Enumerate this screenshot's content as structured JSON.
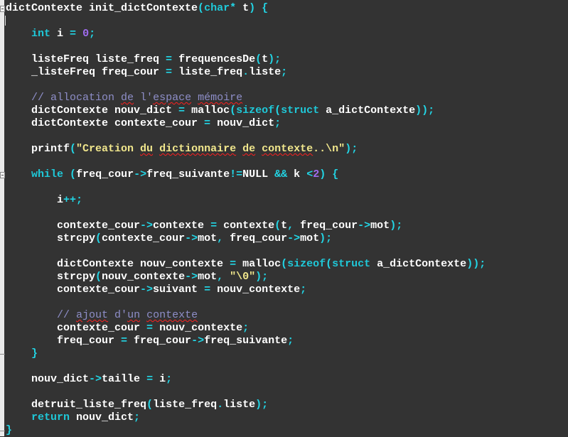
{
  "editor": {
    "language": "C",
    "colors": {
      "background": "#333333",
      "identifier": "#ffffff",
      "keyword": "#1fc8d8",
      "operator": "#22d6e6",
      "number": "#a06cf0",
      "string": "#f0e68c",
      "comment": "#8e8ec8"
    },
    "fold_markers": [
      {
        "line": 1,
        "type": "fold-open"
      },
      {
        "line": 14,
        "type": "fold-open"
      },
      {
        "line": 28,
        "type": "fold-end"
      },
      {
        "line": 34,
        "type": "fold-end"
      }
    ],
    "lines": [
      [
        {
          "t": "id",
          "v": "dictContexte init_dictContexte"
        },
        {
          "t": "punc",
          "v": "("
        },
        {
          "t": "kw",
          "v": "char"
        },
        {
          "t": "op",
          "v": "*"
        },
        {
          "t": "id",
          "v": " t"
        },
        {
          "t": "punc",
          "v": ")"
        },
        {
          "t": "id",
          "v": " "
        },
        {
          "t": "punc",
          "v": "{"
        }
      ],
      [],
      [
        {
          "t": "id",
          "v": "    "
        },
        {
          "t": "kw",
          "v": "int"
        },
        {
          "t": "id",
          "v": " i "
        },
        {
          "t": "op",
          "v": "="
        },
        {
          "t": "id",
          "v": " "
        },
        {
          "t": "num",
          "v": "0"
        },
        {
          "t": "punc",
          "v": ";"
        }
      ],
      [],
      [
        {
          "t": "id",
          "v": "    listeFreq liste_freq "
        },
        {
          "t": "op",
          "v": "="
        },
        {
          "t": "id",
          "v": " frequencesDe"
        },
        {
          "t": "punc",
          "v": "("
        },
        {
          "t": "id",
          "v": "t"
        },
        {
          "t": "punc",
          "v": ");"
        }
      ],
      [
        {
          "t": "id",
          "v": "    _listeFreq freq_cour "
        },
        {
          "t": "op",
          "v": "="
        },
        {
          "t": "id",
          "v": " liste_freq"
        },
        {
          "t": "punc",
          "v": "."
        },
        {
          "t": "id",
          "v": "liste"
        },
        {
          "t": "punc",
          "v": ";"
        }
      ],
      [],
      [
        {
          "t": "com",
          "v": "    // allocation "
        },
        {
          "t": "com",
          "v": "de",
          "s": true
        },
        {
          "t": "com",
          "v": " l'"
        },
        {
          "t": "com",
          "v": "espace",
          "s": true
        },
        {
          "t": "com",
          "v": " "
        },
        {
          "t": "com",
          "v": "mémoire",
          "s": true
        }
      ],
      [
        {
          "t": "id",
          "v": "    dictContexte nouv_dict "
        },
        {
          "t": "op",
          "v": "="
        },
        {
          "t": "id",
          "v": " malloc"
        },
        {
          "t": "punc",
          "v": "("
        },
        {
          "t": "kw",
          "v": "sizeof"
        },
        {
          "t": "punc",
          "v": "("
        },
        {
          "t": "kw",
          "v": "struct"
        },
        {
          "t": "id",
          "v": " a_dictContexte"
        },
        {
          "t": "punc",
          "v": "));"
        }
      ],
      [
        {
          "t": "id",
          "v": "    dictContexte contexte_cour "
        },
        {
          "t": "op",
          "v": "="
        },
        {
          "t": "id",
          "v": " nouv_dict"
        },
        {
          "t": "punc",
          "v": ";"
        }
      ],
      [],
      [
        {
          "t": "id",
          "v": "    printf"
        },
        {
          "t": "punc",
          "v": "("
        },
        {
          "t": "str",
          "v": "\"Creation "
        },
        {
          "t": "str",
          "v": "du",
          "s": true
        },
        {
          "t": "str",
          "v": " "
        },
        {
          "t": "str",
          "v": "dictionnaire",
          "s": true
        },
        {
          "t": "str",
          "v": " "
        },
        {
          "t": "str",
          "v": "de",
          "s": true
        },
        {
          "t": "str",
          "v": " "
        },
        {
          "t": "str",
          "v": "contexte",
          "s": true
        },
        {
          "t": "str",
          "v": "..\\n\""
        },
        {
          "t": "punc",
          "v": ");"
        }
      ],
      [],
      [
        {
          "t": "id",
          "v": "    "
        },
        {
          "t": "kw",
          "v": "while"
        },
        {
          "t": "id",
          "v": " "
        },
        {
          "t": "punc",
          "v": "("
        },
        {
          "t": "id",
          "v": "freq_cour"
        },
        {
          "t": "op",
          "v": "->"
        },
        {
          "t": "id",
          "v": "freq_suivante"
        },
        {
          "t": "op",
          "v": "!="
        },
        {
          "t": "id",
          "v": "NULL "
        },
        {
          "t": "op",
          "v": "&&"
        },
        {
          "t": "id",
          "v": " k "
        },
        {
          "t": "op",
          "v": "<"
        },
        {
          "t": "num",
          "v": "2"
        },
        {
          "t": "punc",
          "v": ")"
        },
        {
          "t": "id",
          "v": " "
        },
        {
          "t": "punc",
          "v": "{"
        }
      ],
      [],
      [
        {
          "t": "id",
          "v": "        i"
        },
        {
          "t": "op",
          "v": "++"
        },
        {
          "t": "punc",
          "v": ";"
        }
      ],
      [],
      [
        {
          "t": "id",
          "v": "        contexte_cour"
        },
        {
          "t": "op",
          "v": "->"
        },
        {
          "t": "id",
          "v": "contexte "
        },
        {
          "t": "op",
          "v": "="
        },
        {
          "t": "id",
          "v": " contexte"
        },
        {
          "t": "punc",
          "v": "("
        },
        {
          "t": "id",
          "v": "t"
        },
        {
          "t": "punc",
          "v": ","
        },
        {
          "t": "id",
          "v": " freq_cour"
        },
        {
          "t": "op",
          "v": "->"
        },
        {
          "t": "id",
          "v": "mot"
        },
        {
          "t": "punc",
          "v": ");"
        }
      ],
      [
        {
          "t": "id",
          "v": "        strcpy"
        },
        {
          "t": "punc",
          "v": "("
        },
        {
          "t": "id",
          "v": "contexte_cour"
        },
        {
          "t": "op",
          "v": "->"
        },
        {
          "t": "id",
          "v": "mot"
        },
        {
          "t": "punc",
          "v": ","
        },
        {
          "t": "id",
          "v": " freq_cour"
        },
        {
          "t": "op",
          "v": "->"
        },
        {
          "t": "id",
          "v": "mot"
        },
        {
          "t": "punc",
          "v": ");"
        }
      ],
      [],
      [
        {
          "t": "id",
          "v": "        dictContexte nouv_contexte "
        },
        {
          "t": "op",
          "v": "="
        },
        {
          "t": "id",
          "v": " malloc"
        },
        {
          "t": "punc",
          "v": "("
        },
        {
          "t": "kw",
          "v": "sizeof"
        },
        {
          "t": "punc",
          "v": "("
        },
        {
          "t": "kw",
          "v": "struct"
        },
        {
          "t": "id",
          "v": " a_dictContexte"
        },
        {
          "t": "punc",
          "v": "));"
        }
      ],
      [
        {
          "t": "id",
          "v": "        strcpy"
        },
        {
          "t": "punc",
          "v": "("
        },
        {
          "t": "id",
          "v": "nouv_contexte"
        },
        {
          "t": "op",
          "v": "->"
        },
        {
          "t": "id",
          "v": "mot"
        },
        {
          "t": "punc",
          "v": ","
        },
        {
          "t": "id",
          "v": " "
        },
        {
          "t": "str",
          "v": "\"\\0\""
        },
        {
          "t": "punc",
          "v": ");"
        }
      ],
      [
        {
          "t": "id",
          "v": "        contexte_cour"
        },
        {
          "t": "op",
          "v": "->"
        },
        {
          "t": "id",
          "v": "suivant "
        },
        {
          "t": "op",
          "v": "="
        },
        {
          "t": "id",
          "v": " nouv_contexte"
        },
        {
          "t": "punc",
          "v": ";"
        }
      ],
      [],
      [
        {
          "t": "com",
          "v": "        // "
        },
        {
          "t": "com",
          "v": "ajout",
          "s": true
        },
        {
          "t": "com",
          "v": " d'"
        },
        {
          "t": "com",
          "v": "un",
          "s": true
        },
        {
          "t": "com",
          "v": " "
        },
        {
          "t": "com",
          "v": "contexte",
          "s": true
        }
      ],
      [
        {
          "t": "id",
          "v": "        contexte_cour "
        },
        {
          "t": "op",
          "v": "="
        },
        {
          "t": "id",
          "v": " nouv_contexte"
        },
        {
          "t": "punc",
          "v": ";"
        }
      ],
      [
        {
          "t": "id",
          "v": "        freq_cour "
        },
        {
          "t": "op",
          "v": "="
        },
        {
          "t": "id",
          "v": " freq_cour"
        },
        {
          "t": "op",
          "v": "->"
        },
        {
          "t": "id",
          "v": "freq_suivante"
        },
        {
          "t": "punc",
          "v": ";"
        }
      ],
      [
        {
          "t": "id",
          "v": "    "
        },
        {
          "t": "punc",
          "v": "}"
        }
      ],
      [],
      [
        {
          "t": "id",
          "v": "    nouv_dict"
        },
        {
          "t": "op",
          "v": "->"
        },
        {
          "t": "id",
          "v": "taille "
        },
        {
          "t": "op",
          "v": "="
        },
        {
          "t": "id",
          "v": " i"
        },
        {
          "t": "punc",
          "v": ";"
        }
      ],
      [],
      [
        {
          "t": "id",
          "v": "    detruit_liste_freq"
        },
        {
          "t": "punc",
          "v": "("
        },
        {
          "t": "id",
          "v": "liste_freq"
        },
        {
          "t": "punc",
          "v": "."
        },
        {
          "t": "id",
          "v": "liste"
        },
        {
          "t": "punc",
          "v": ");"
        }
      ],
      [
        {
          "t": "id",
          "v": "    "
        },
        {
          "t": "kw",
          "v": "return"
        },
        {
          "t": "id",
          "v": " nouv_dict"
        },
        {
          "t": "punc",
          "v": ";"
        }
      ],
      [
        {
          "t": "punc",
          "v": "}"
        }
      ]
    ]
  }
}
